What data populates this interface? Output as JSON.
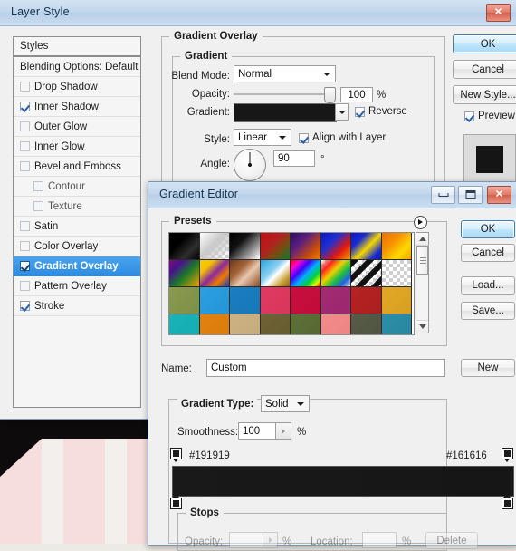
{
  "layer_style": {
    "title": "Layer Style",
    "window_buttons": {
      "close": "✕"
    },
    "styles_panel": {
      "header": "Styles",
      "blending_options": "Blending Options: Default",
      "items": [
        {
          "label": "Drop Shadow",
          "checked": false,
          "sub": false,
          "selected": false
        },
        {
          "label": "Inner Shadow",
          "checked": true,
          "sub": false,
          "selected": false
        },
        {
          "label": "Outer Glow",
          "checked": false,
          "sub": false,
          "selected": false
        },
        {
          "label": "Inner Glow",
          "checked": false,
          "sub": false,
          "selected": false
        },
        {
          "label": "Bevel and Emboss",
          "checked": false,
          "sub": false,
          "selected": false
        },
        {
          "label": "Contour",
          "checked": false,
          "sub": true,
          "selected": false
        },
        {
          "label": "Texture",
          "checked": false,
          "sub": true,
          "selected": false
        },
        {
          "label": "Satin",
          "checked": false,
          "sub": false,
          "selected": false
        },
        {
          "label": "Color Overlay",
          "checked": false,
          "sub": false,
          "selected": false
        },
        {
          "label": "Gradient Overlay",
          "checked": true,
          "sub": false,
          "selected": true
        },
        {
          "label": "Pattern Overlay",
          "checked": false,
          "sub": false,
          "selected": false
        },
        {
          "label": "Stroke",
          "checked": true,
          "sub": false,
          "selected": false
        }
      ]
    },
    "gradient_overlay": {
      "group_title": "Gradient Overlay",
      "inner_group_title": "Gradient",
      "blend_mode_label": "Blend Mode:",
      "blend_mode_value": "Normal",
      "opacity_label": "Opacity:",
      "opacity_value": "100",
      "opacity_unit": "%",
      "gradient_label": "Gradient:",
      "gradient_preview_color": "#171717",
      "reverse_label": "Reverse",
      "reverse_checked": true,
      "style_label": "Style:",
      "style_value": "Linear",
      "align_label": "Align with Layer",
      "align_checked": true,
      "angle_label": "Angle:",
      "angle_value": "90",
      "angle_unit": "°"
    },
    "side_buttons": {
      "ok": "OK",
      "cancel": "Cancel",
      "new_style": "New Style...",
      "preview_label": "Preview",
      "preview_checked": true,
      "preview_swatch_color": "#151515"
    }
  },
  "gradient_editor": {
    "title": "Gradient Editor",
    "window_buttons": {
      "minimize": "minimize-icon",
      "maximize": "maximize-icon",
      "close": "✕"
    },
    "presets": {
      "legend": "Presets",
      "menu_icon": "presets-menu-icon",
      "rows": [
        [
          {
            "name": "black-to-dark",
            "css": "linear-gradient(135deg,#000000 0%,#000000 35%,#2e2e2e 70%,#000000 100%)"
          },
          {
            "name": "white-to-transparent",
            "css": "linear-gradient(135deg,#ffffff 0%,#c9c9c9 45%,rgba(255,255,255,0) 100%)",
            "checker": true
          },
          {
            "name": "black-to-white",
            "css": "linear-gradient(135deg,#000000 0%,#111111 35%,#ffffff 100%)"
          },
          {
            "name": "red-green",
            "css": "linear-gradient(135deg,#c01010 0%,#b42020 40%,#7a4a10 65%,#0f7a2a 100%)"
          },
          {
            "name": "violet-orange",
            "css": "linear-gradient(135deg,#2a1060 0%,#5b1f80 35%,#c24a10 70%,#f07a00 100%)"
          },
          {
            "name": "blue-red-yellow",
            "css": "linear-gradient(135deg,#0a18c8 0%,#2030d0 35%,#e01810 68%,#f0a000 100%)"
          },
          {
            "name": "blue-yellow-blue",
            "css": "linear-gradient(135deg,#0a18c8 0%,#1a2cd0 28%,#f5d800 55%,#1a2cd0 82%,#0a18c8 100%)"
          },
          {
            "name": "orange-yellow",
            "css": "linear-gradient(135deg,#f07000 0%,#f59000 35%,#ffd800 70%,#f5a000 100%)"
          }
        ],
        [
          {
            "name": "violet-green-orange",
            "css": "linear-gradient(135deg,#7a1070 0%,#4a1090 25%,#1a7a2a 55%,#f0a000 100%)"
          },
          {
            "name": "yellow-violet-orange-blue",
            "css": "linear-gradient(135deg,#f5d000 0%,#f5c000 25%,#8a2aa0 50%,#f07a00 72%,#1a3ac0 100%)"
          },
          {
            "name": "copper",
            "css": "linear-gradient(135deg,#6a3a18 0%,#a5663a 35%,#e8c8b0 58%,#8a4a22 100%)"
          },
          {
            "name": "chrome",
            "css": "linear-gradient(135deg,#2aa0e0 0%,#8ad0f0 40%,#ffffff 55%,#c8a030 80%,#8a6a10 100%)"
          },
          {
            "name": "spectrum",
            "css": "linear-gradient(135deg,#ff0000 0%,#ff00d0 18%,#4000ff 36%,#00b0ff 54%,#00d040 72%,#d0ff00 88%,#ff0000 100%)"
          },
          {
            "name": "transparent-rainbow",
            "css": "linear-gradient(135deg,rgba(255,255,255,0) 0%,#ff2020 22%,#f0d000 42%,#20c040 62%,#2060e0 82%,rgba(255,255,255,0) 100%)",
            "checker": true
          },
          {
            "name": "transparent-stripes",
            "css": "repeating-linear-gradient(135deg,#111111 0px,#111111 6px,rgba(255,255,255,0) 6px,rgba(255,255,255,0) 12px)",
            "checker": true
          },
          {
            "name": "transparent",
            "css": "none",
            "checker": true
          }
        ],
        [
          {
            "name": "olive-green",
            "css": "linear-gradient(135deg,#8a9a4e 0%,#7e9048 100%)"
          },
          {
            "name": "sky-blue",
            "css": "linear-gradient(135deg,#2b9fdf 0%,#2496d8 100%)"
          },
          {
            "name": "steel-blue",
            "css": "linear-gradient(135deg,#1a7ec0 0%,#1878b8 100%)"
          },
          {
            "name": "pink-red",
            "css": "linear-gradient(135deg,#e03a62 0%,#d8365c 100%)"
          },
          {
            "name": "crimson",
            "css": "linear-gradient(135deg,#c80f3e 0%,#c00c38 100%)"
          },
          {
            "name": "magenta-purple",
            "css": "linear-gradient(135deg,#a32a72 0%,#9c2870 100%)"
          },
          {
            "name": "dark-red",
            "css": "linear-gradient(135deg,#b52222 0%,#ad1f20 100%)"
          },
          {
            "name": "goldenrod",
            "css": "linear-gradient(135deg,#e0a825 0%,#d8a020 100%)"
          }
        ],
        [
          {
            "name": "teal",
            "css": "linear-gradient(135deg,#18b4b8 0%,#14acb0 100%)"
          },
          {
            "name": "orange",
            "css": "linear-gradient(135deg,#e2820e 0%,#da7c0c 100%)"
          },
          {
            "name": "tan",
            "css": "linear-gradient(135deg,#ccb384 0%,#c4ab7c 100%)"
          },
          {
            "name": "dark-olive",
            "css": "linear-gradient(135deg,#6e6236 0%,#665a30 100%)"
          },
          {
            "name": "moss-green",
            "css": "linear-gradient(135deg,#5e7038 0%,#566832 100%)"
          },
          {
            "name": "salmon",
            "css": "linear-gradient(135deg,#f48b8b 0%,#ec8484 100%)"
          },
          {
            "name": "gray-green",
            "css": "linear-gradient(135deg,#565c46 0%,#4e5440 100%)"
          },
          {
            "name": "steel-teal",
            "css": "linear-gradient(135deg,#2c8ea8 0%,#2886a0 100%)"
          }
        ]
      ]
    },
    "name_label": "Name:",
    "name_value": "Custom",
    "new_button": "New",
    "gradient_type": {
      "legend_label": "Gradient Type:",
      "value": "Solid",
      "smoothness_label": "Smoothness:",
      "smoothness_value": "100",
      "smoothness_unit": "%"
    },
    "gradient_strip": {
      "left_hex": "#191919",
      "right_hex": "#161616",
      "left_color": "#191919",
      "right_color": "#161616"
    },
    "stops": {
      "legend": "Stops",
      "opacity_label": "Opacity:",
      "opacity_value": "",
      "opacity_unit": "%",
      "location_label": "Location:",
      "location_value": "",
      "location_unit": "%",
      "delete_button": "Delete"
    },
    "side_buttons": {
      "ok": "OK",
      "cancel": "Cancel",
      "load": "Load...",
      "save": "Save..."
    }
  }
}
